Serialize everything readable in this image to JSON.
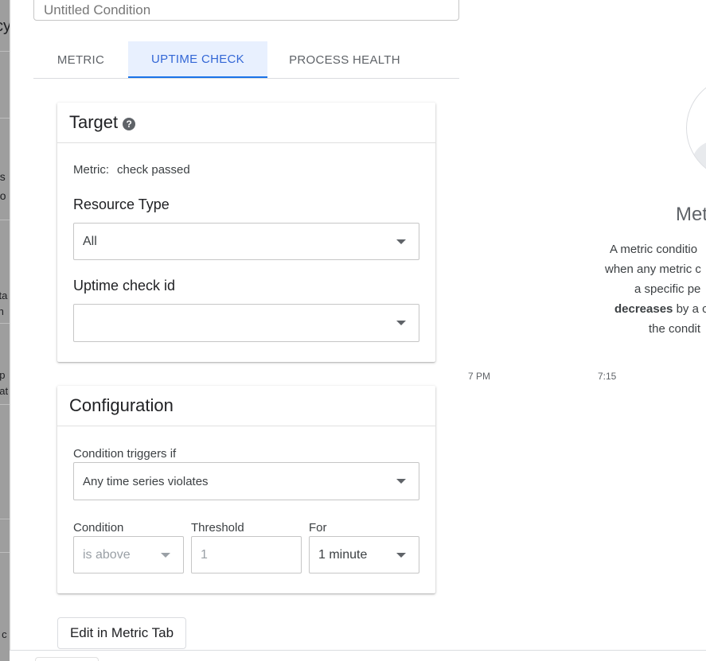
{
  "background_fragments": [
    "cy",
    "os",
    "oo",
    "sta",
    "th",
    "up",
    "eat",
    "s c"
  ],
  "condition_title": {
    "value": "Untitled Condition"
  },
  "tabs": [
    {
      "label": "METRIC"
    },
    {
      "label": "UPTIME CHECK"
    },
    {
      "label": "PROCESS HEALTH"
    }
  ],
  "active_tab": "UPTIME CHECK",
  "target": {
    "title": "Target",
    "help_icon": "help-circle-icon",
    "metric_label": "Metric:",
    "metric_value": "check passed",
    "resource_type_label": "Resource Type",
    "resource_type_value": "All",
    "uptime_check_label": "Uptime check id",
    "uptime_check_value": ""
  },
  "configuration": {
    "title": "Configuration",
    "triggers_label": "Condition triggers if",
    "triggers_value": "Any time series violates",
    "condition_label": "Condition",
    "condition_value": "is above",
    "threshold_label": "Threshold",
    "threshold_placeholder": "1",
    "for_label": "For",
    "for_value": "1 minute"
  },
  "chart_axis": {
    "tick_1": "7 PM",
    "tick_2": "7:15"
  },
  "empty_state": {
    "title": "Met",
    "lines": [
      "A metric conditio",
      "when any metric c",
      "a specific pe"
    ],
    "line4_bold": "decreases",
    "line4_rest": " by a c",
    "line5": "the condit"
  },
  "edit_button": "Edit in Metric Tab",
  "colors": {
    "accent": "#1a73e8",
    "active_tab_bg": "#e8f0fe",
    "sidebar_bg": "#9e9e9e"
  }
}
